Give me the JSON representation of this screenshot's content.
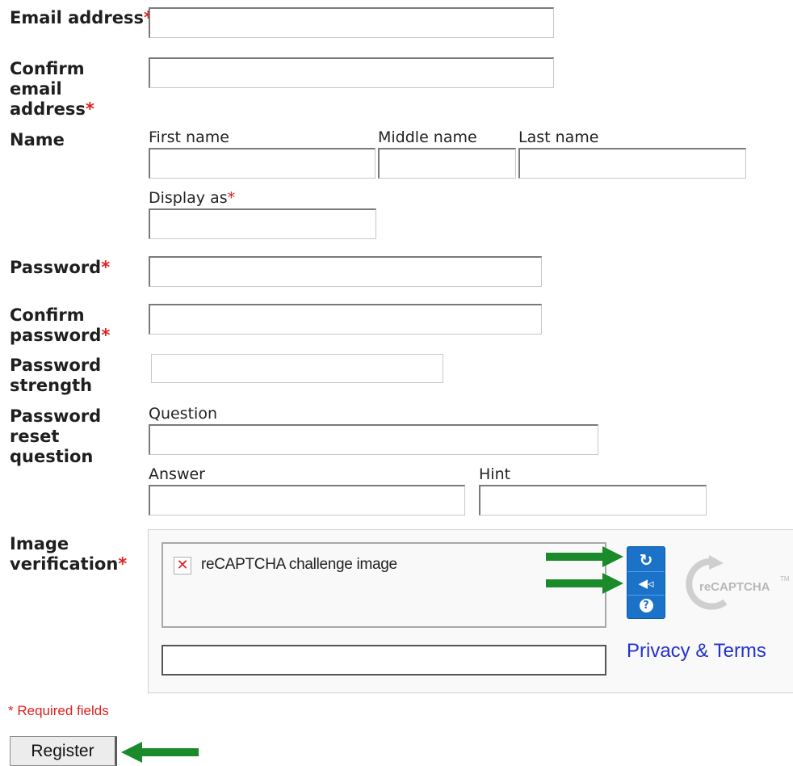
{
  "form": {
    "email_label": "Email address",
    "confirm_email_label": "Confirm email address",
    "name_label": "Name",
    "first_name_label": "First name",
    "middle_name_label": "Middle name",
    "last_name_label": "Last name",
    "display_as_label": "Display as",
    "password_label": "Password",
    "confirm_password_label": "Confirm password",
    "password_strength_label": "Password strength",
    "reset_question_label": "Password reset question",
    "question_label": "Question",
    "answer_label": "Answer",
    "hint_label": "Hint",
    "image_verification_label": "Image verification",
    "required_marker": "*",
    "required_note": "* Required fields",
    "register_button": "Register"
  },
  "captcha": {
    "image_alt_text": "reCAPTCHA challenge image",
    "privacy_link": "Privacy & Terms",
    "logo_text": "reCAPTCHA",
    "logo_tm": "TM",
    "buttons": [
      "refresh-icon",
      "audio-icon",
      "help-icon"
    ]
  },
  "colors": {
    "required": "#e02020",
    "link": "#2233cc",
    "captcha_buttons": "#1a73c8",
    "annotation_arrow": "#1a8a2a"
  }
}
